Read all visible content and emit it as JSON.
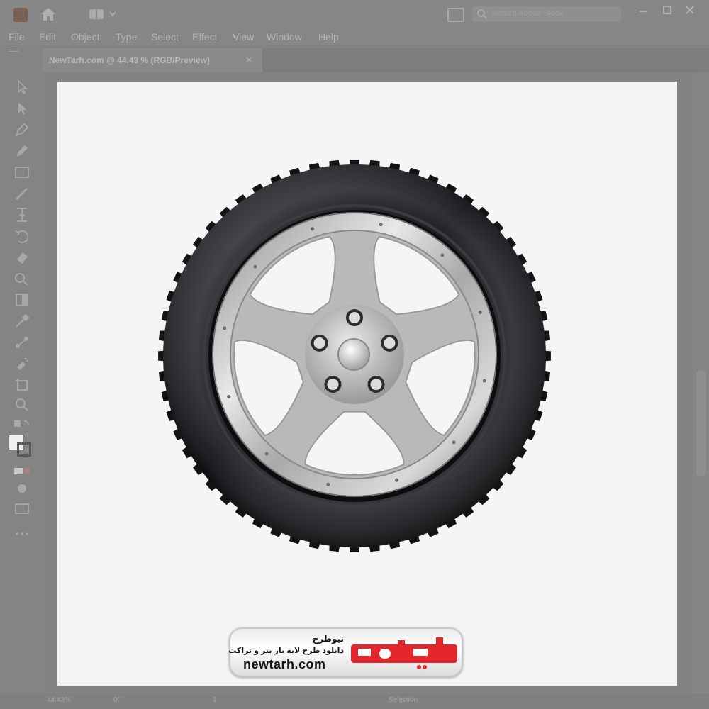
{
  "window": {
    "search_placeholder": "Search Adobe Stock"
  },
  "menu": {
    "items": [
      "File",
      "Edit",
      "Object",
      "Type",
      "Select",
      "Effect",
      "View",
      "Window",
      "Help"
    ]
  },
  "document": {
    "tab_label": "NewTarh.com @ 44.43 % (RGB/Preview)",
    "close_glyph": "×"
  },
  "status": {
    "zoom": "44.43%",
    "rotation": "0°",
    "artboard_number": "1",
    "mode": "Selection"
  },
  "watermark": {
    "brand_fa": "نیوطرح",
    "tagline_fa": "دانلود طرح لایه باز بنر و تراکت",
    "url": "newtarh.com",
    "logo_fa": "نیوطرح",
    "logo_color": "#e3262c"
  },
  "colors": {
    "chrome": "#878787",
    "artboard": "#f5f5f6",
    "tire": "#1c1d20",
    "rim": "#c8c8c8"
  },
  "tools": [
    "selection-tool",
    "direct-selection-tool",
    "pen-tool",
    "curvature-tool",
    "rectangle-tool",
    "paintbrush-tool",
    "width-tool",
    "rotate-tool",
    "eraser-tool",
    "shape-builder-tool",
    "gradient-tool",
    "eyedropper-tool",
    "blend-tool",
    "symbol-sprayer-tool",
    "artboard-tool",
    "zoom-tool"
  ]
}
